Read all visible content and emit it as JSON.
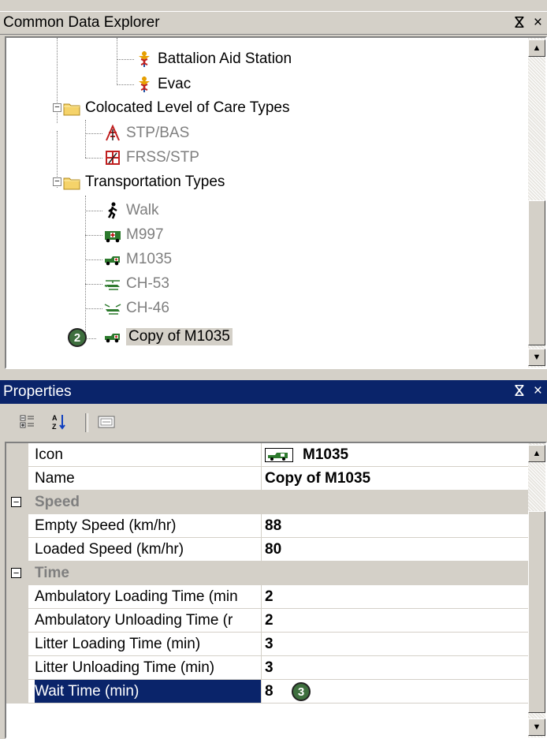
{
  "explorer": {
    "title": "Common Data Explorer",
    "pin_glyph": "ⴵ",
    "close_glyph": "×",
    "nodes": [
      {
        "label": "Battalion Aid Station",
        "icon": "caduceus-icon",
        "gray": false
      },
      {
        "label": "Evac",
        "icon": "caduceus-icon",
        "gray": false
      },
      {
        "label": "Colocated Level of Care Types",
        "icon": "folder-icon",
        "gray": false
      },
      {
        "label": "STP/BAS",
        "icon": "colocated-care-icon",
        "gray": true
      },
      {
        "label": "FRSS/STP",
        "icon": "colocated-care-icon",
        "gray": true
      },
      {
        "label": "Transportation Types",
        "icon": "folder-icon",
        "gray": false
      },
      {
        "label": "Walk",
        "icon": "walking-person-icon",
        "gray": true
      },
      {
        "label": "M997",
        "icon": "ambulance-icon",
        "gray": true
      },
      {
        "label": "M1035",
        "icon": "humvee-icon",
        "gray": true
      },
      {
        "label": "CH-53",
        "icon": "helicopter-icon",
        "gray": true
      },
      {
        "label": "CH-46",
        "icon": "helicopter-icon",
        "gray": true
      },
      {
        "label": "Copy of M1035",
        "icon": "humvee-icon",
        "gray": false,
        "selected": true
      }
    ],
    "expander_glyph": "−",
    "badge": "2"
  },
  "properties": {
    "title": "Properties",
    "pin_glyph": "ⴵ",
    "close_glyph": "×",
    "rows": [
      {
        "type": "prop",
        "name": "Icon",
        "value": "M1035",
        "has_icon": true
      },
      {
        "type": "prop",
        "name": "Name",
        "value": "Copy of M1035"
      },
      {
        "type": "cat",
        "name": "Speed"
      },
      {
        "type": "prop",
        "name": "Empty Speed (km/hr)",
        "value": "88"
      },
      {
        "type": "prop",
        "name": "Loaded Speed (km/hr)",
        "value": "80"
      },
      {
        "type": "cat",
        "name": "Time"
      },
      {
        "type": "prop",
        "name": "Ambulatory Loading Time (min",
        "value": "2"
      },
      {
        "type": "prop",
        "name": "Ambulatory Unloading Time (r",
        "value": "2"
      },
      {
        "type": "prop",
        "name": "Litter Loading Time (min)",
        "value": "3"
      },
      {
        "type": "prop",
        "name": "Litter Unloading Time (min)",
        "value": "3"
      },
      {
        "type": "prop",
        "name": "Wait Time (min)",
        "value": "8",
        "selected": true
      }
    ],
    "cat_glyph": "−",
    "badge": "3"
  },
  "colors": {
    "panel": "#d4d0c8",
    "active_title": "#0a246a",
    "badge": "#3e6f3e"
  }
}
